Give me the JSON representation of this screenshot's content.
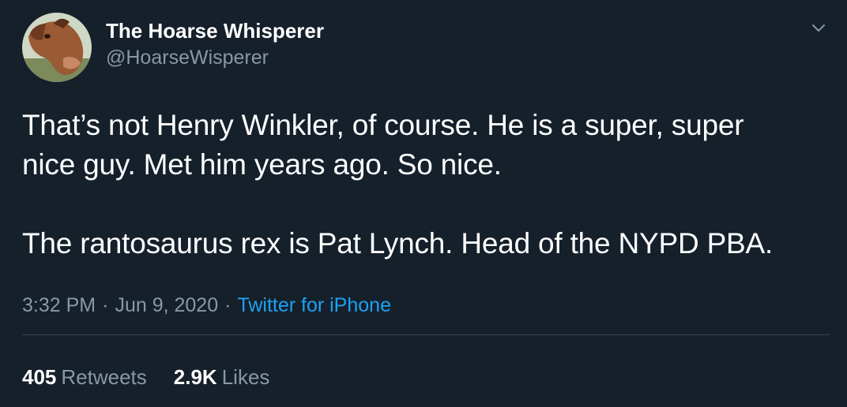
{
  "colors": {
    "background": "#15202b",
    "primary_text": "#ffffff",
    "secondary_text": "#8899a6",
    "link": "#1da1f2",
    "divider": "#38444d"
  },
  "author": {
    "display_name": "The Hoarse Whisperer",
    "handle": "@HoarseWisperer",
    "avatar_icon": "horse-avatar"
  },
  "menu": {
    "icon": "chevron-down-icon"
  },
  "tweet": {
    "paragraphs": [
      "That’s not Henry Winkler, of course. He is a super, super",
      "nice guy. Met him years ago. So nice.",
      "The rantosaurus rex is Pat Lynch. Head of the NYPD PBA."
    ],
    "time": "3:32 PM",
    "separator": "·",
    "date": "Jun 9, 2020",
    "source": "Twitter for iPhone"
  },
  "stats": {
    "retweets": {
      "count": "405",
      "label": "Retweets"
    },
    "likes": {
      "count": "2.9K",
      "label": "Likes"
    }
  }
}
